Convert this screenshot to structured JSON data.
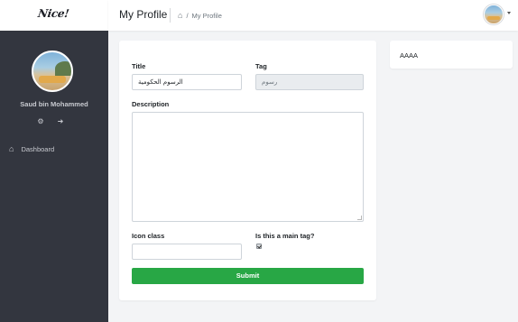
{
  "brand": {
    "logo_text": "Nice!"
  },
  "sidebar": {
    "user_name": "Saud bin Mohammed",
    "settings_icon": "gear-icon",
    "logout_icon": "sign-out-icon",
    "nav": [
      {
        "label": "Dashboard",
        "icon": "home-icon"
      }
    ]
  },
  "header": {
    "title": "My Profile",
    "breadcrumb": {
      "separator": "/",
      "current": "My Profile",
      "home_icon": "home-icon"
    }
  },
  "form": {
    "title_label": "Title",
    "title_value": "الرسوم الحكومية",
    "tag_label": "Tag",
    "tag_value": "رسوم",
    "description_label": "Description",
    "description_value": "",
    "icon_class_label": "Icon class",
    "icon_class_value": "",
    "main_tag_label": "Is this a main tag?",
    "main_tag_checked": true,
    "submit_label": "Submit"
  },
  "side_card": {
    "text": "AAAA"
  },
  "colors": {
    "sidebar_bg": "#33363f",
    "submit_bg": "#28a745",
    "page_bg": "#f3f4f6"
  }
}
